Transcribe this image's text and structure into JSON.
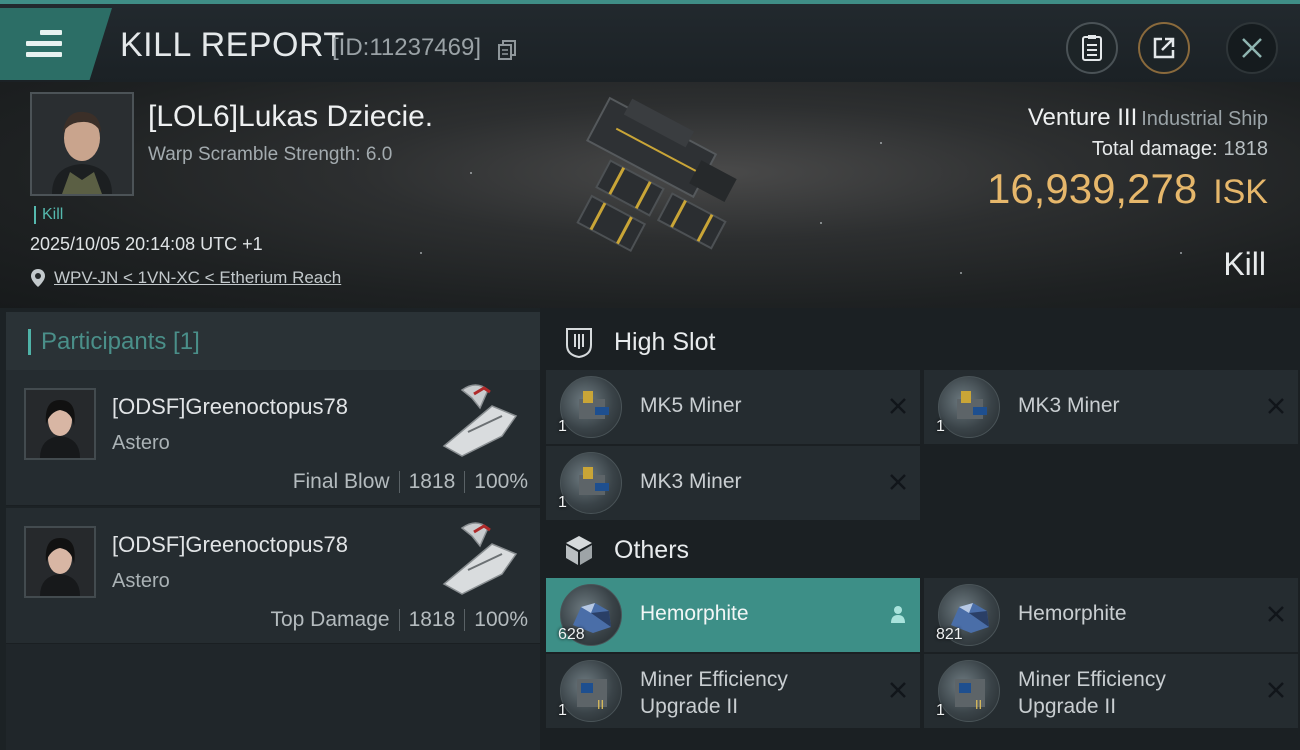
{
  "header": {
    "title": "KILL REPORT",
    "report_id": "[ID:11237469]"
  },
  "victim": {
    "name": "[LOL6]Lukas Dziecie.",
    "warp_scramble": "Warp Scramble Strength: 6.0",
    "tag": "Kill",
    "datetime": "2025/10/05 20:14:08 UTC +1",
    "location": "WPV-JN < 1VN-XC < Etherium Reach",
    "ship_name": "Venture III",
    "ship_class": "Industrial Ship",
    "total_damage_label": "Total damage:",
    "total_damage": "1818",
    "isk_value": "16,939,278",
    "isk_unit": "ISK",
    "result": "Kill"
  },
  "participants": {
    "title": "Participants [1]",
    "rows": [
      {
        "name": "[ODSF]Greenoctopus78",
        "ship": "Astero",
        "role": "Final Blow",
        "damage": "1818",
        "percent": "100%"
      },
      {
        "name": "[ODSF]Greenoctopus78",
        "ship": "Astero",
        "role": "Top Damage",
        "damage": "1818",
        "percent": "100%"
      }
    ]
  },
  "fitting": {
    "high_slot": {
      "title": "High Slot",
      "items": [
        {
          "name": "MK5 Miner",
          "qty": "1"
        },
        {
          "name": "MK3 Miner",
          "qty": "1"
        },
        {
          "name": "MK3 Miner",
          "qty": "1"
        }
      ]
    },
    "others": {
      "title": "Others",
      "items": [
        {
          "name": "Hemorphite",
          "qty": "628",
          "status": "dropped"
        },
        {
          "name": "Hemorphite",
          "qty": "821",
          "status": "destroyed"
        },
        {
          "name_line1": "Miner Efficiency",
          "name_line2": "Upgrade II",
          "qty": "1",
          "status": "destroyed"
        },
        {
          "name_line1": "Miner Efficiency",
          "name_line2": "Upgrade II",
          "qty": "1",
          "status": "destroyed"
        }
      ]
    }
  },
  "icons": {
    "menu": "hamburger-icon",
    "copy": "copy-icon",
    "clipboard": "clipboard-icon",
    "share": "share-icon",
    "close": "close-icon",
    "location": "location-pin-icon",
    "high_slot": "high-slot-icon",
    "others": "cube-icon",
    "destroyed": "x-icon",
    "dropped": "person-icon"
  },
  "colors": {
    "accent_teal": "#3d8f87",
    "isk_gold": "#e6b76b",
    "background": "#14191d"
  }
}
